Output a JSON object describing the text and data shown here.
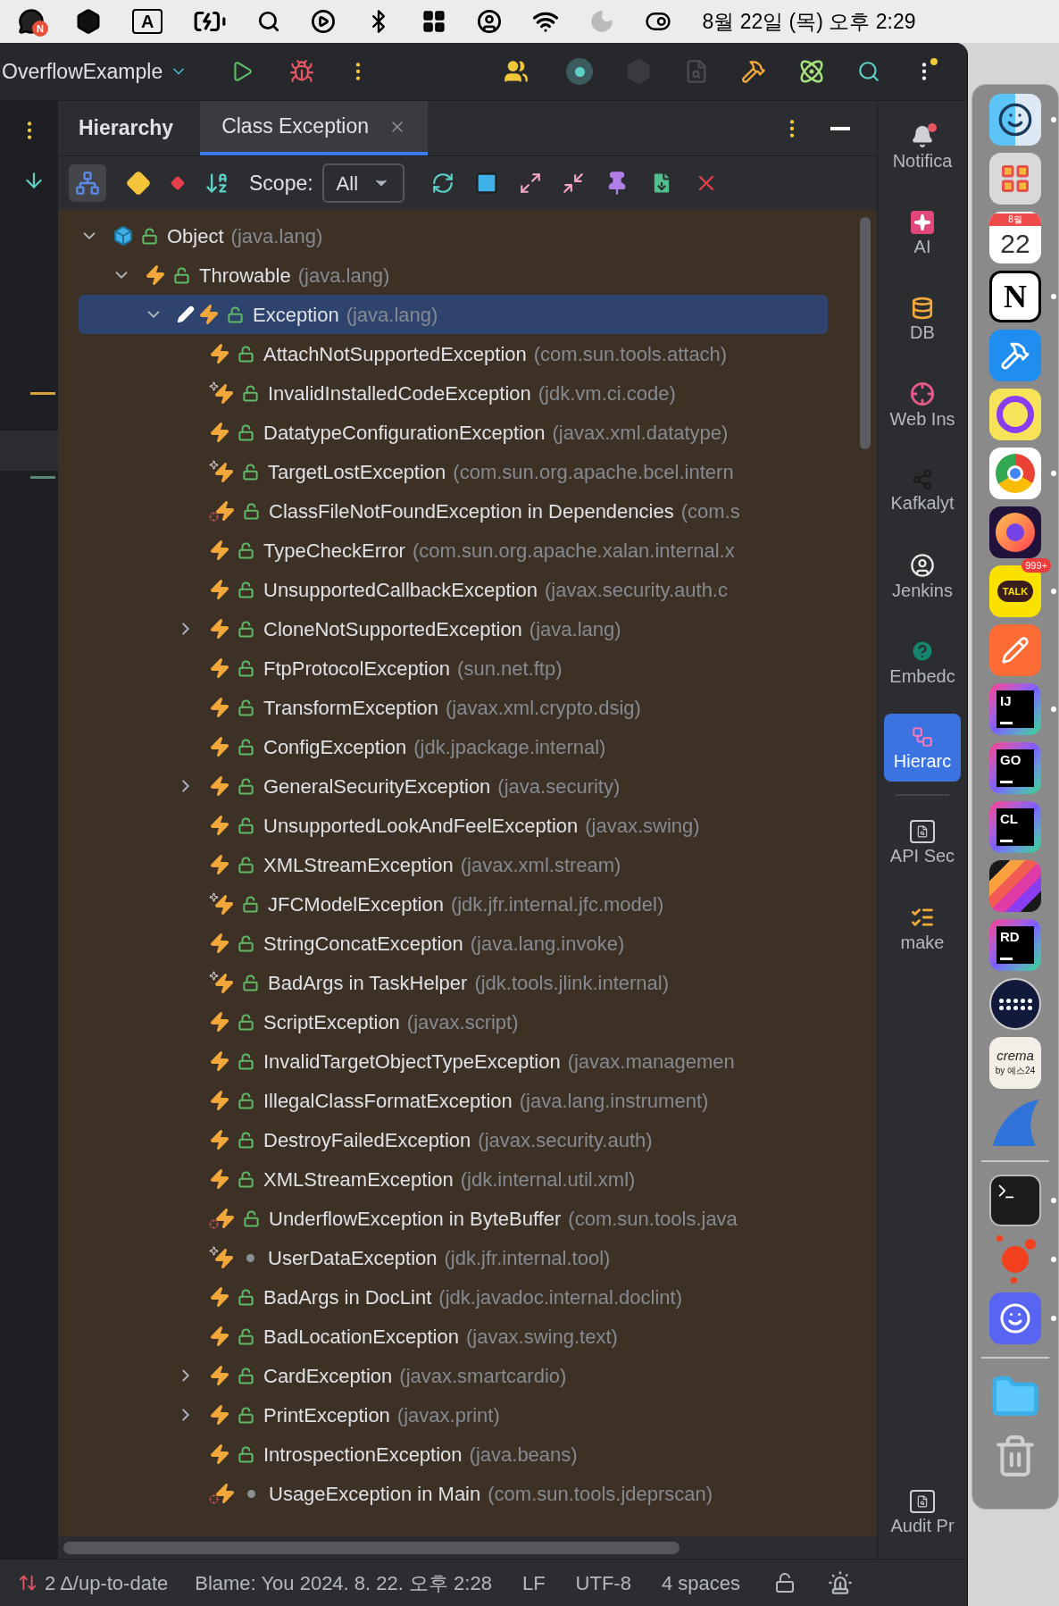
{
  "menu_bar": {
    "chat_badge": "N",
    "input_source": "A",
    "clock": "8월 22일 (목) 오후 2:29"
  },
  "title_bar": {
    "project": "OverflowExample"
  },
  "tool_window": {
    "title": "Hierarchy",
    "tabs": [
      {
        "label": "Class Exception",
        "selected": true
      }
    ],
    "scope_label": "Scope:",
    "scope_value": "All"
  },
  "tree": [
    {
      "name": "Object",
      "package": "(java.lang)",
      "kind": "class",
      "public": true,
      "expanded": true,
      "editing": false,
      "selected": false,
      "children": [
        {
          "name": "Throwable",
          "package": "(java.lang)",
          "kind": "exception",
          "public": true,
          "expanded": true,
          "editing": false,
          "selected": false,
          "children": [
            {
              "name": "Exception",
              "package": "(java.lang)",
              "kind": "exception",
              "public": true,
              "expanded": true,
              "editing": true,
              "selected": true,
              "children": [
                {
                  "name": "AttachNotSupportedException",
                  "package": "(com.sun.tools.attach)",
                  "kind": "exception",
                  "public": true,
                  "editing": false,
                  "selected": false
                },
                {
                  "name": "InvalidInstalledCodeException",
                  "package": "(jdk.vm.ci.code)",
                  "kind": "spark",
                  "public": true,
                  "editing": false,
                  "selected": false
                },
                {
                  "name": "DatatypeConfigurationException",
                  "package": "(javax.xml.datatype)",
                  "kind": "exception",
                  "public": true,
                  "editing": false,
                  "selected": false
                },
                {
                  "name": "TargetLostException",
                  "package": "(com.sun.org.apache.bcel.intern",
                  "kind": "spark",
                  "public": true,
                  "editing": false,
                  "selected": false
                },
                {
                  "name": "ClassFileNotFoundException in Dependencies",
                  "package": "(com.s",
                  "kind": "target",
                  "public": true,
                  "editing": false,
                  "selected": false
                },
                {
                  "name": "TypeCheckError",
                  "package": "(com.sun.org.apache.xalan.internal.x",
                  "kind": "exception",
                  "public": true,
                  "editing": false,
                  "selected": false
                },
                {
                  "name": "UnsupportedCallbackException",
                  "package": "(javax.security.auth.c",
                  "kind": "exception",
                  "public": true,
                  "editing": false,
                  "selected": false
                },
                {
                  "name": "CloneNotSupportedException",
                  "package": "(java.lang)",
                  "kind": "exception",
                  "public": true,
                  "expanded": false,
                  "editing": false,
                  "selected": false
                },
                {
                  "name": "FtpProtocolException",
                  "package": "(sun.net.ftp)",
                  "kind": "exception",
                  "public": true,
                  "editing": false,
                  "selected": false
                },
                {
                  "name": "TransformException",
                  "package": "(javax.xml.crypto.dsig)",
                  "kind": "exception",
                  "public": true,
                  "editing": false,
                  "selected": false
                },
                {
                  "name": "ConfigException",
                  "package": "(jdk.jpackage.internal)",
                  "kind": "exception",
                  "public": true,
                  "editing": false,
                  "selected": false
                },
                {
                  "name": "GeneralSecurityException",
                  "package": "(java.security)",
                  "kind": "exception",
                  "public": true,
                  "expanded": false,
                  "editing": false,
                  "selected": false
                },
                {
                  "name": "UnsupportedLookAndFeelException",
                  "package": "(javax.swing)",
                  "kind": "exception",
                  "public": true,
                  "editing": false,
                  "selected": false
                },
                {
                  "name": "XMLStreamException",
                  "package": "(javax.xml.stream)",
                  "kind": "exception",
                  "public": true,
                  "editing": false,
                  "selected": false
                },
                {
                  "name": "JFCModelException",
                  "package": "(jdk.jfr.internal.jfc.model)",
                  "kind": "spark",
                  "public": true,
                  "editing": false,
                  "selected": false
                },
                {
                  "name": "StringConcatException",
                  "package": "(java.lang.invoke)",
                  "kind": "exception",
                  "public": true,
                  "editing": false,
                  "selected": false
                },
                {
                  "name": "BadArgs in TaskHelper",
                  "package": "(jdk.tools.jlink.internal)",
                  "kind": "spark",
                  "public": true,
                  "editing": false,
                  "selected": false
                },
                {
                  "name": "ScriptException",
                  "package": "(javax.script)",
                  "kind": "exception",
                  "public": true,
                  "editing": false,
                  "selected": false
                },
                {
                  "name": "InvalidTargetObjectTypeException",
                  "package": "(javax.managemen",
                  "kind": "exception",
                  "public": true,
                  "editing": false,
                  "selected": false
                },
                {
                  "name": "IllegalClassFormatException",
                  "package": "(java.lang.instrument)",
                  "kind": "exception",
                  "public": true,
                  "editing": false,
                  "selected": false
                },
                {
                  "name": "DestroyFailedException",
                  "package": "(javax.security.auth)",
                  "kind": "exception",
                  "public": true,
                  "editing": false,
                  "selected": false
                },
                {
                  "name": "XMLStreamException",
                  "package": "(jdk.internal.util.xml)",
                  "kind": "exception",
                  "public": true,
                  "editing": false,
                  "selected": false
                },
                {
                  "name": "UnderflowException in ByteBuffer",
                  "package": "(com.sun.tools.java",
                  "kind": "target",
                  "public": true,
                  "editing": false,
                  "selected": false
                },
                {
                  "name": "UserDataException",
                  "package": "(jdk.jfr.internal.tool)",
                  "kind": "spark",
                  "public": false,
                  "editing": false,
                  "selected": false
                },
                {
                  "name": "BadArgs in DocLint",
                  "package": "(jdk.javadoc.internal.doclint)",
                  "kind": "exception",
                  "public": true,
                  "editing": false,
                  "selected": false
                },
                {
                  "name": "BadLocationException",
                  "package": "(javax.swing.text)",
                  "kind": "exception",
                  "public": true,
                  "editing": false,
                  "selected": false
                },
                {
                  "name": "CardException",
                  "package": "(javax.smartcardio)",
                  "kind": "exception",
                  "public": true,
                  "expanded": false,
                  "editing": false,
                  "selected": false
                },
                {
                  "name": "PrintException",
                  "package": "(javax.print)",
                  "kind": "exception",
                  "public": true,
                  "expanded": false,
                  "editing": false,
                  "selected": false
                },
                {
                  "name": "IntrospectionException",
                  "package": "(java.beans)",
                  "kind": "exception",
                  "public": true,
                  "editing": false,
                  "selected": false
                },
                {
                  "name": "UsageException in Main",
                  "package": "(com.sun.tools.jdeprscan)",
                  "kind": "target",
                  "public": false,
                  "editing": false,
                  "selected": false
                }
              ]
            }
          ]
        }
      ]
    }
  ],
  "tool_windows": [
    {
      "kind": "bell",
      "label": "Notifica",
      "selected": false
    },
    {
      "kind": "ai",
      "label": "AI",
      "selected": false
    },
    {
      "kind": "database",
      "label": "DB",
      "selected": false
    },
    {
      "kind": "target",
      "label": "Web Ins",
      "selected": false
    },
    {
      "kind": "graph",
      "label": "Kafkalyt",
      "selected": false
    },
    {
      "kind": "butler",
      "label": "Jenkins",
      "selected": false
    },
    {
      "kind": "help",
      "label": "Embedc",
      "selected": false
    },
    {
      "kind": "hierarchy",
      "label": "Hierarc",
      "selected": true
    },
    {
      "kind": "api",
      "label": "API Sec",
      "selected": false
    },
    {
      "kind": "checklist",
      "label": "make",
      "selected": false
    }
  ],
  "bottom_tool_windows": [
    {
      "kind": "api",
      "label": "Audit Pr",
      "selected": false
    }
  ],
  "status_bar": {
    "vcs": "2 Δ/up-to-date",
    "blame": "Blame: You 2024. 8. 22. 오후 2:28",
    "line_separator": "LF",
    "encoding": "UTF-8",
    "indent": "4 spaces"
  },
  "dock": [
    {
      "kind": "finder",
      "running": true
    },
    {
      "kind": "launchpad",
      "running": false
    },
    {
      "kind": "calendar",
      "month": "8월",
      "day": "22",
      "running": false
    },
    {
      "kind": "notion",
      "text": "N",
      "running": true
    },
    {
      "kind": "appstore",
      "running": false
    },
    {
      "kind": "wave",
      "running": false
    },
    {
      "kind": "chrome",
      "running": true
    },
    {
      "kind": "firefox",
      "running": false
    },
    {
      "kind": "talk",
      "text": "TALK",
      "badge": "999+",
      "running": true
    },
    {
      "kind": "postman",
      "running": false
    },
    {
      "kind": "jetbrains",
      "text": "IJ",
      "running": true
    },
    {
      "kind": "jetbrains",
      "text": "GO",
      "running": false
    },
    {
      "kind": "jetbrains",
      "text": "CL",
      "running": false
    },
    {
      "kind": "stripes",
      "running": false
    },
    {
      "kind": "jetbrains",
      "text": "RD",
      "running": false
    },
    {
      "kind": "dots",
      "running": false
    },
    {
      "kind": "crema",
      "text": "crema",
      "subtext": "by 예스24",
      "running": false
    },
    {
      "kind": "shark",
      "running": false
    },
    {
      "kind": "separator"
    },
    {
      "kind": "terminal",
      "running": true
    },
    {
      "kind": "splash",
      "running": true
    },
    {
      "kind": "discord",
      "running": true
    },
    {
      "kind": "separator"
    },
    {
      "kind": "folder",
      "running": false
    },
    {
      "kind": "trash",
      "running": false
    }
  ]
}
